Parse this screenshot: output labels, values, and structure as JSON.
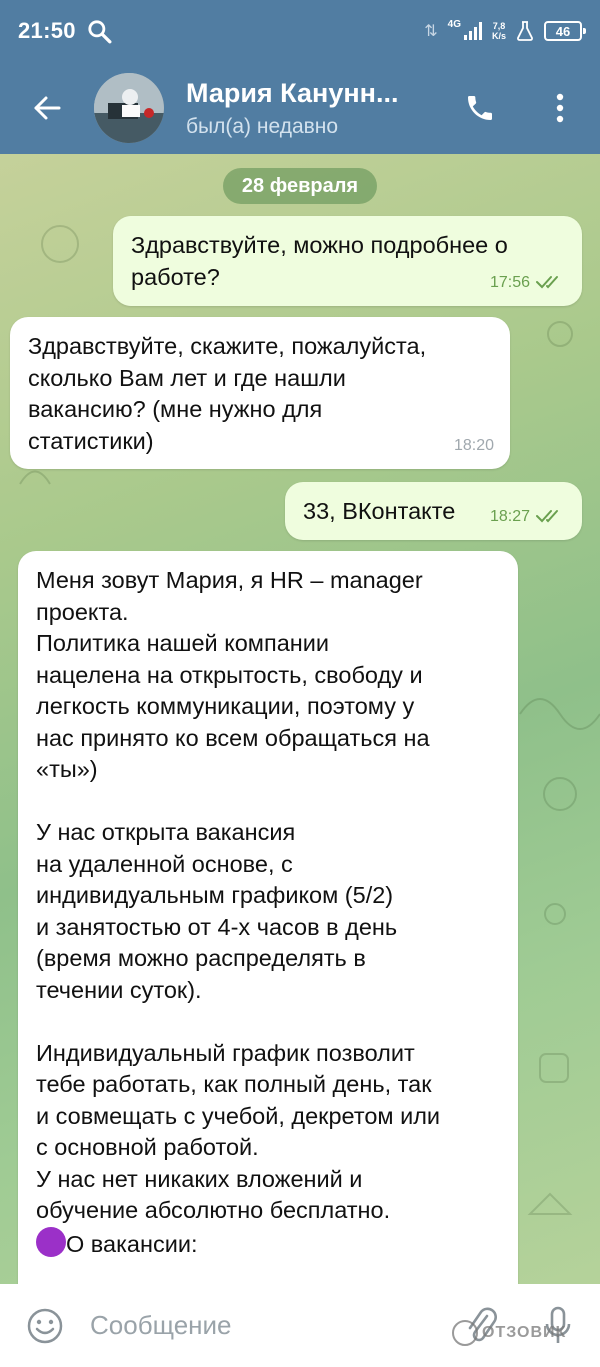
{
  "status_bar": {
    "time": "21:50",
    "network": "4G",
    "speed_value": "7,8",
    "speed_unit": "K/s",
    "battery": "46"
  },
  "header": {
    "contact_name": "Мария Канунн...",
    "contact_status": "был(а) недавно"
  },
  "chat": {
    "date_divider": "28 февраля",
    "messages": [
      {
        "direction": "out",
        "text": "Здравствуйте, можно подробнее о\nработе?",
        "time": "17:56",
        "read": true
      },
      {
        "direction": "in",
        "text": "Здравствуйте, скажите, пожалуйста,\nсколько Вам лет и где нашли\nвакансию? (мне нужно для\nстатистики)",
        "time": "18:20"
      },
      {
        "direction": "out",
        "text": "33, ВКонтакте",
        "time": "18:27",
        "read": true
      },
      {
        "direction": "in",
        "text": "Меня зовут Мария, я HR – manager\nпроекта.\nПолитика нашей компании\nнацелена на открытость, свободу и\nлегкость коммуникации, поэтому у\nнас принято ко всем обращаться на\n«ты»)\n\nУ нас открыта вакансия\nна удаленной основе, с\nиндивидуальным графиком (5/2)\nи занятостью от 4-х часов в день\n(время можно распределять в\nтечении суток).\n\nИндивидуальный график позволит\nтебе работать, как полный день, так\nи совмещать с учебой, декретом или\nс основной работой.\nУ нас нет никаких вложений и\nобучение абсолютно бесплатно.\n",
        "last_line": "О вакансии:",
        "emoji": "purple-circle"
      }
    ]
  },
  "input_bar": {
    "placeholder": "Сообщение"
  },
  "watermark": "ОТЗОВИК",
  "colors": {
    "header_bg": "#517da2",
    "outgoing_bubble": "#effdde",
    "incoming_bubble": "#ffffff",
    "read_check": "#6aa04f"
  }
}
